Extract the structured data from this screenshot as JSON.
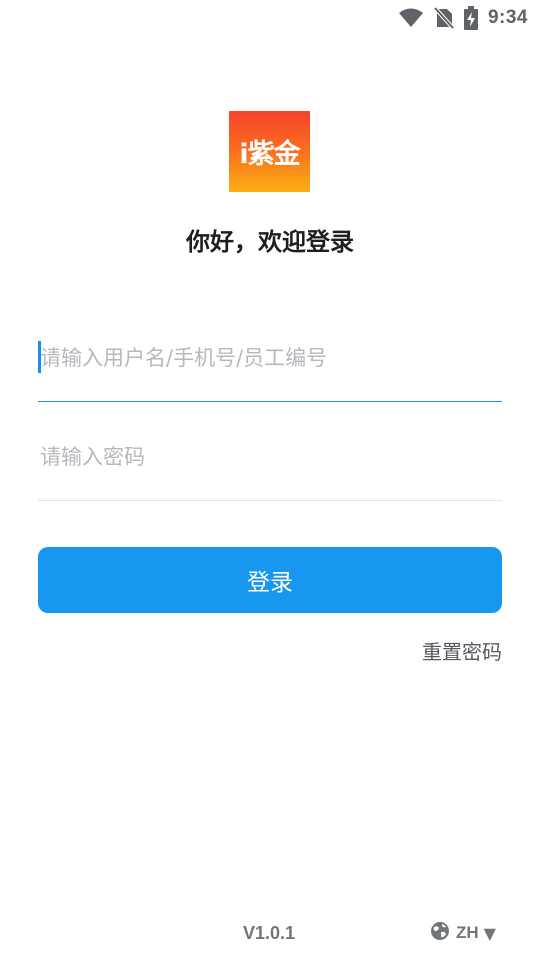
{
  "status_bar": {
    "time": "9:34",
    "icons": [
      "wifi-icon",
      "no-sim-icon",
      "battery-charging-icon"
    ]
  },
  "app": {
    "logo_text": "i紫金",
    "welcome": "你好，欢迎登录"
  },
  "form": {
    "username_placeholder": "请输入用户名/手机号/员工编号",
    "username_value": "",
    "password_placeholder": "请输入密码",
    "password_value": "",
    "login_label": "登录",
    "reset_label": "重置密码"
  },
  "footer": {
    "version": "V1.0.1",
    "language": "ZH",
    "dropdown_glyph": "▼"
  },
  "colors": {
    "accent": "#1797f0",
    "logo_top": "#f5432a",
    "logo_bottom": "#fcb013"
  }
}
